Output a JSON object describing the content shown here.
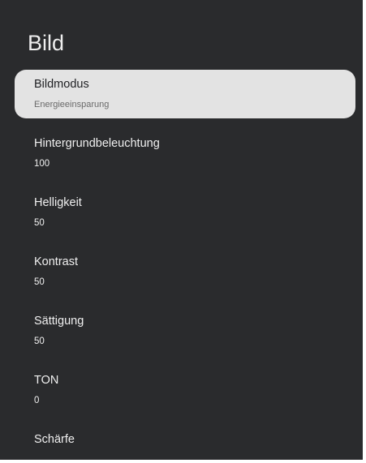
{
  "header": {
    "title": "Bild"
  },
  "menu": {
    "items": [
      {
        "label": "Bildmodus",
        "value": "Energieeinsparung"
      },
      {
        "label": "Hintergrundbeleuchtung",
        "value": "100"
      },
      {
        "label": "Helligkeit",
        "value": "50"
      },
      {
        "label": "Kontrast",
        "value": "50"
      },
      {
        "label": "Sättigung",
        "value": "50"
      },
      {
        "label": "TON",
        "value": "0"
      },
      {
        "label": "Schärfe"
      }
    ]
  }
}
